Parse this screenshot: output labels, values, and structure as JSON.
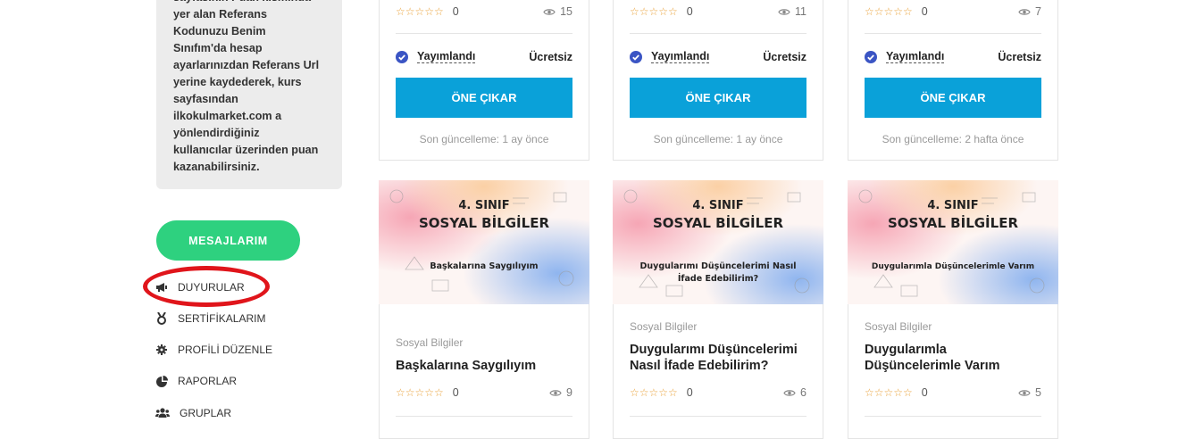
{
  "sidebar": {
    "info_text": "sayfasının Puan kısmında\nyer alan Referans\nKodunuzu Benim\nSınıfım'da hesap\nayarlarınızdan Referans Url\nyerine kaydederek, kurs\nsayfasından\nilkokulmarket.com a\nyönlendirdiğiniz\nkullanıcılar üzerinden puan\nkazanabilirsiniz.",
    "messages_button": "MESAJLARIM",
    "menu": [
      {
        "label": "DUYURULAR",
        "icon": "megaphone-icon"
      },
      {
        "label": "SERTİFİKALARIM",
        "icon": "medal-icon"
      },
      {
        "label": "PROFİLİ DÜZENLE",
        "icon": "gear-icon"
      },
      {
        "label": "RAPORLAR",
        "icon": "pie-chart-icon"
      },
      {
        "label": "GRUPLAR",
        "icon": "users-icon"
      }
    ],
    "annotation_color": "#e0151b"
  },
  "top_cards": [
    {
      "rating": "0",
      "views": "15",
      "status": "Yayımlandı",
      "price": "Ücretsiz",
      "button": "ÖNE ÇIKAR",
      "updated": "Son güncelleme: 1 ay önce"
    },
    {
      "rating": "0",
      "views": "11",
      "status": "Yayımlandı",
      "price": "Ücretsiz",
      "button": "ÖNE ÇIKAR",
      "updated": "Son güncelleme: 1 ay önce"
    },
    {
      "rating": "0",
      "views": "7",
      "status": "Yayımlandı",
      "price": "Ücretsiz",
      "button": "ÖNE ÇIKAR",
      "updated": "Son güncelleme: 2 hafta önce"
    }
  ],
  "bottom_cards": [
    {
      "thumb_grade": "4. SINIF",
      "thumb_subject": "SOSYAL BİLGİLER",
      "thumb_topic_lines": [
        "Başkalarına Saygılıyım"
      ],
      "category": "Sosyal Bilgiler",
      "title_lines": [
        "Başkalarına Saygılıyım"
      ],
      "rating": "0",
      "views": "9"
    },
    {
      "thumb_grade": "4. SINIF",
      "thumb_subject": "SOSYAL BİLGİLER",
      "thumb_topic_lines": [
        "Duygularımı Düşüncelerimi Nasıl",
        "İfade Edebilirim?"
      ],
      "category": "Sosyal Bilgiler",
      "title_lines": [
        "Duygularımı Düşüncelerimi",
        "Nasıl İfade Edebilirim?"
      ],
      "rating": "0",
      "views": "6"
    },
    {
      "thumb_grade": "4. SINIF",
      "thumb_subject": "SOSYAL BİLGİLER",
      "thumb_topic_lines": [
        "Duygularımla Düşüncelerimle Varım"
      ],
      "category": "Sosyal Bilgiler",
      "title_lines": [
        "Duygularımla",
        "Düşüncelerimle Varım"
      ],
      "rating": "0",
      "views": "5"
    }
  ],
  "colors": {
    "accent_blue": "#0aa1d9",
    "accent_green": "#2ed17f",
    "star": "#e9a23b",
    "check": "#3b55c4"
  }
}
